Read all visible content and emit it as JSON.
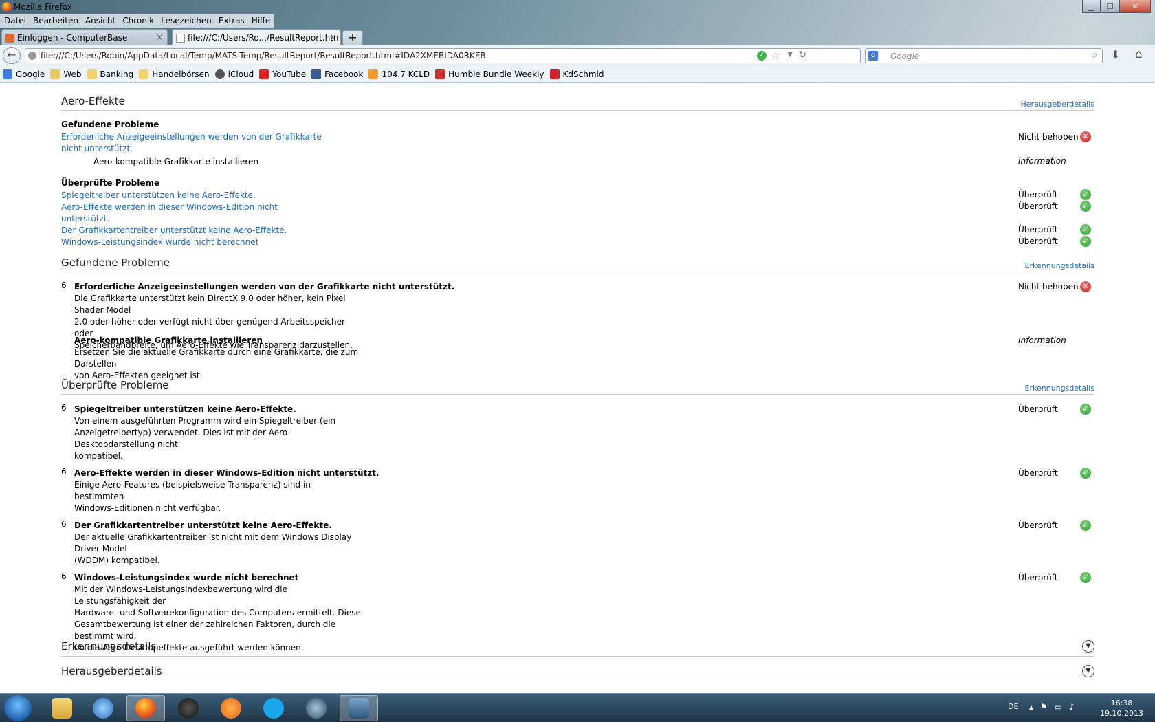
{
  "window": {
    "title": "Mozilla Firefox"
  },
  "menu": [
    "Datei",
    "Bearbeiten",
    "Ansicht",
    "Chronik",
    "Lesezeichen",
    "Extras",
    "Hilfe"
  ],
  "tabs": [
    {
      "label": "Einloggen - ComputerBase",
      "active": false
    },
    {
      "label": "file:///C:/Users/Ro.../ResultReport.html",
      "active": true
    }
  ],
  "nav": {
    "url": "file:///C:/Users/Robin/AppData/Local/Temp/MATS-Temp/ResultReport/ResultReport.html#IDA2XMEBIDA0RKEB",
    "search_placeholder": "Google"
  },
  "bookmarks": [
    "Google",
    "Web",
    "Banking",
    "Handelbörsen",
    "iCloud",
    "YouTube",
    "Facebook",
    "104.7 KCLD",
    "Humble Bundle Weekly",
    "KdSchmid"
  ],
  "aero": {
    "heading": "Aero-Effekte",
    "link": "Herausgeberdetails",
    "found_heading": "Gefundene Probleme",
    "found_link_1": "Erforderliche Anzeigeeinstellungen werden von der Grafikkarte",
    "found_link_2": "nicht unterstützt.",
    "found_status": "Nicht behoben",
    "found_sub": "Aero-kompatible Grafikkarte installieren",
    "found_sub_status": "Information",
    "checked_heading": "Überprüfte Probleme",
    "checked": [
      {
        "text": "Spiegeltreiber unterstützen keine Aero-Effekte.",
        "status": "Überprüft"
      },
      {
        "text": "Aero-Effekte werden in dieser Windows-Edition nicht",
        "text2": "unterstützt.",
        "status": "Überprüft"
      },
      {
        "text": "Der Grafikkartentreiber unterstützt keine Aero-Effekte.",
        "status": "Überprüft"
      },
      {
        "text": "Windows-Leistungsindex wurde nicht berechnet",
        "status": "Überprüft"
      }
    ]
  },
  "found_section": {
    "heading": "Gefundene Probleme",
    "link": "Erkennungsdetails",
    "num": "6",
    "item_title": "Erforderliche Anzeigeeinstellungen werden von der Grafikkarte nicht unterstützt.",
    "item_lines": [
      "Die Grafikkarte unterstützt kein DirectX 9.0 oder höher, kein Pixel Shader Model",
      "2.0 oder höher oder verfügt nicht über genügend Arbeitsspeicher oder",
      "Speicherbandbreite, um Aero-Effekte wie Transparenz darzustellen."
    ],
    "item_status": "Nicht behoben",
    "fix_title": "Aero-kompatible Grafikkarte installieren",
    "fix_lines": [
      "Ersetzen Sie die aktuelle Grafikkarte durch eine Grafikkarte, die zum Darstellen",
      "von Aero-Effekten geeignet ist."
    ],
    "fix_status": "Information"
  },
  "checked_section": {
    "heading": "Überprüfte Probleme",
    "link": "Erkennungsdetails",
    "items": [
      {
        "num": "6",
        "title": "Spiegeltreiber unterstützen keine Aero-Effekte.",
        "status": "Überprüft",
        "lines": [
          "Von einem ausgeführten Programm wird ein Spiegeltreiber (ein",
          "Anzeigetreibertyp) verwendet. Dies ist mit der Aero-Desktopdarstellung nicht",
          "kompatibel."
        ]
      },
      {
        "num": "6",
        "title": "Aero-Effekte werden in dieser Windows-Edition nicht unterstützt.",
        "status": "Überprüft",
        "lines": [
          "Einige Aero-Features (beispielsweise Transparenz) sind in bestimmten",
          "Windows-Editionen nicht verfügbar."
        ]
      },
      {
        "num": "6",
        "title": "Der Grafikkartentreiber unterstützt keine Aero-Effekte.",
        "status": "Überprüft",
        "lines": [
          "Der aktuelle Grafikkartentreiber ist nicht mit dem Windows Display Driver Model",
          "(WDDM) kompatibel."
        ]
      },
      {
        "num": "6",
        "title": "Windows-Leistungsindex wurde nicht berechnet",
        "status": "Überprüft",
        "lines": [
          "Mit der Windows-Leistungsindexbewertung wird die Leistungsfähigkeit der",
          "Hardware- und Softwarekonfiguration des Computers ermittelt. Diese",
          "Gesamtbewertung ist einer der zahlreichen Faktoren, durch die bestimmt wird,",
          "ob die Aero-Desktopeffekte ausgeführt werden können."
        ]
      }
    ]
  },
  "collapsed": [
    "Erkennungsdetails",
    "Herausgeberdetails"
  ],
  "taskbar": {
    "lang": "DE",
    "time": "16:38",
    "date": "19.10.2013"
  },
  "colors": {
    "link": "#1b6ac9",
    "ok": "#2f9a33",
    "error": "#c21f1f"
  }
}
